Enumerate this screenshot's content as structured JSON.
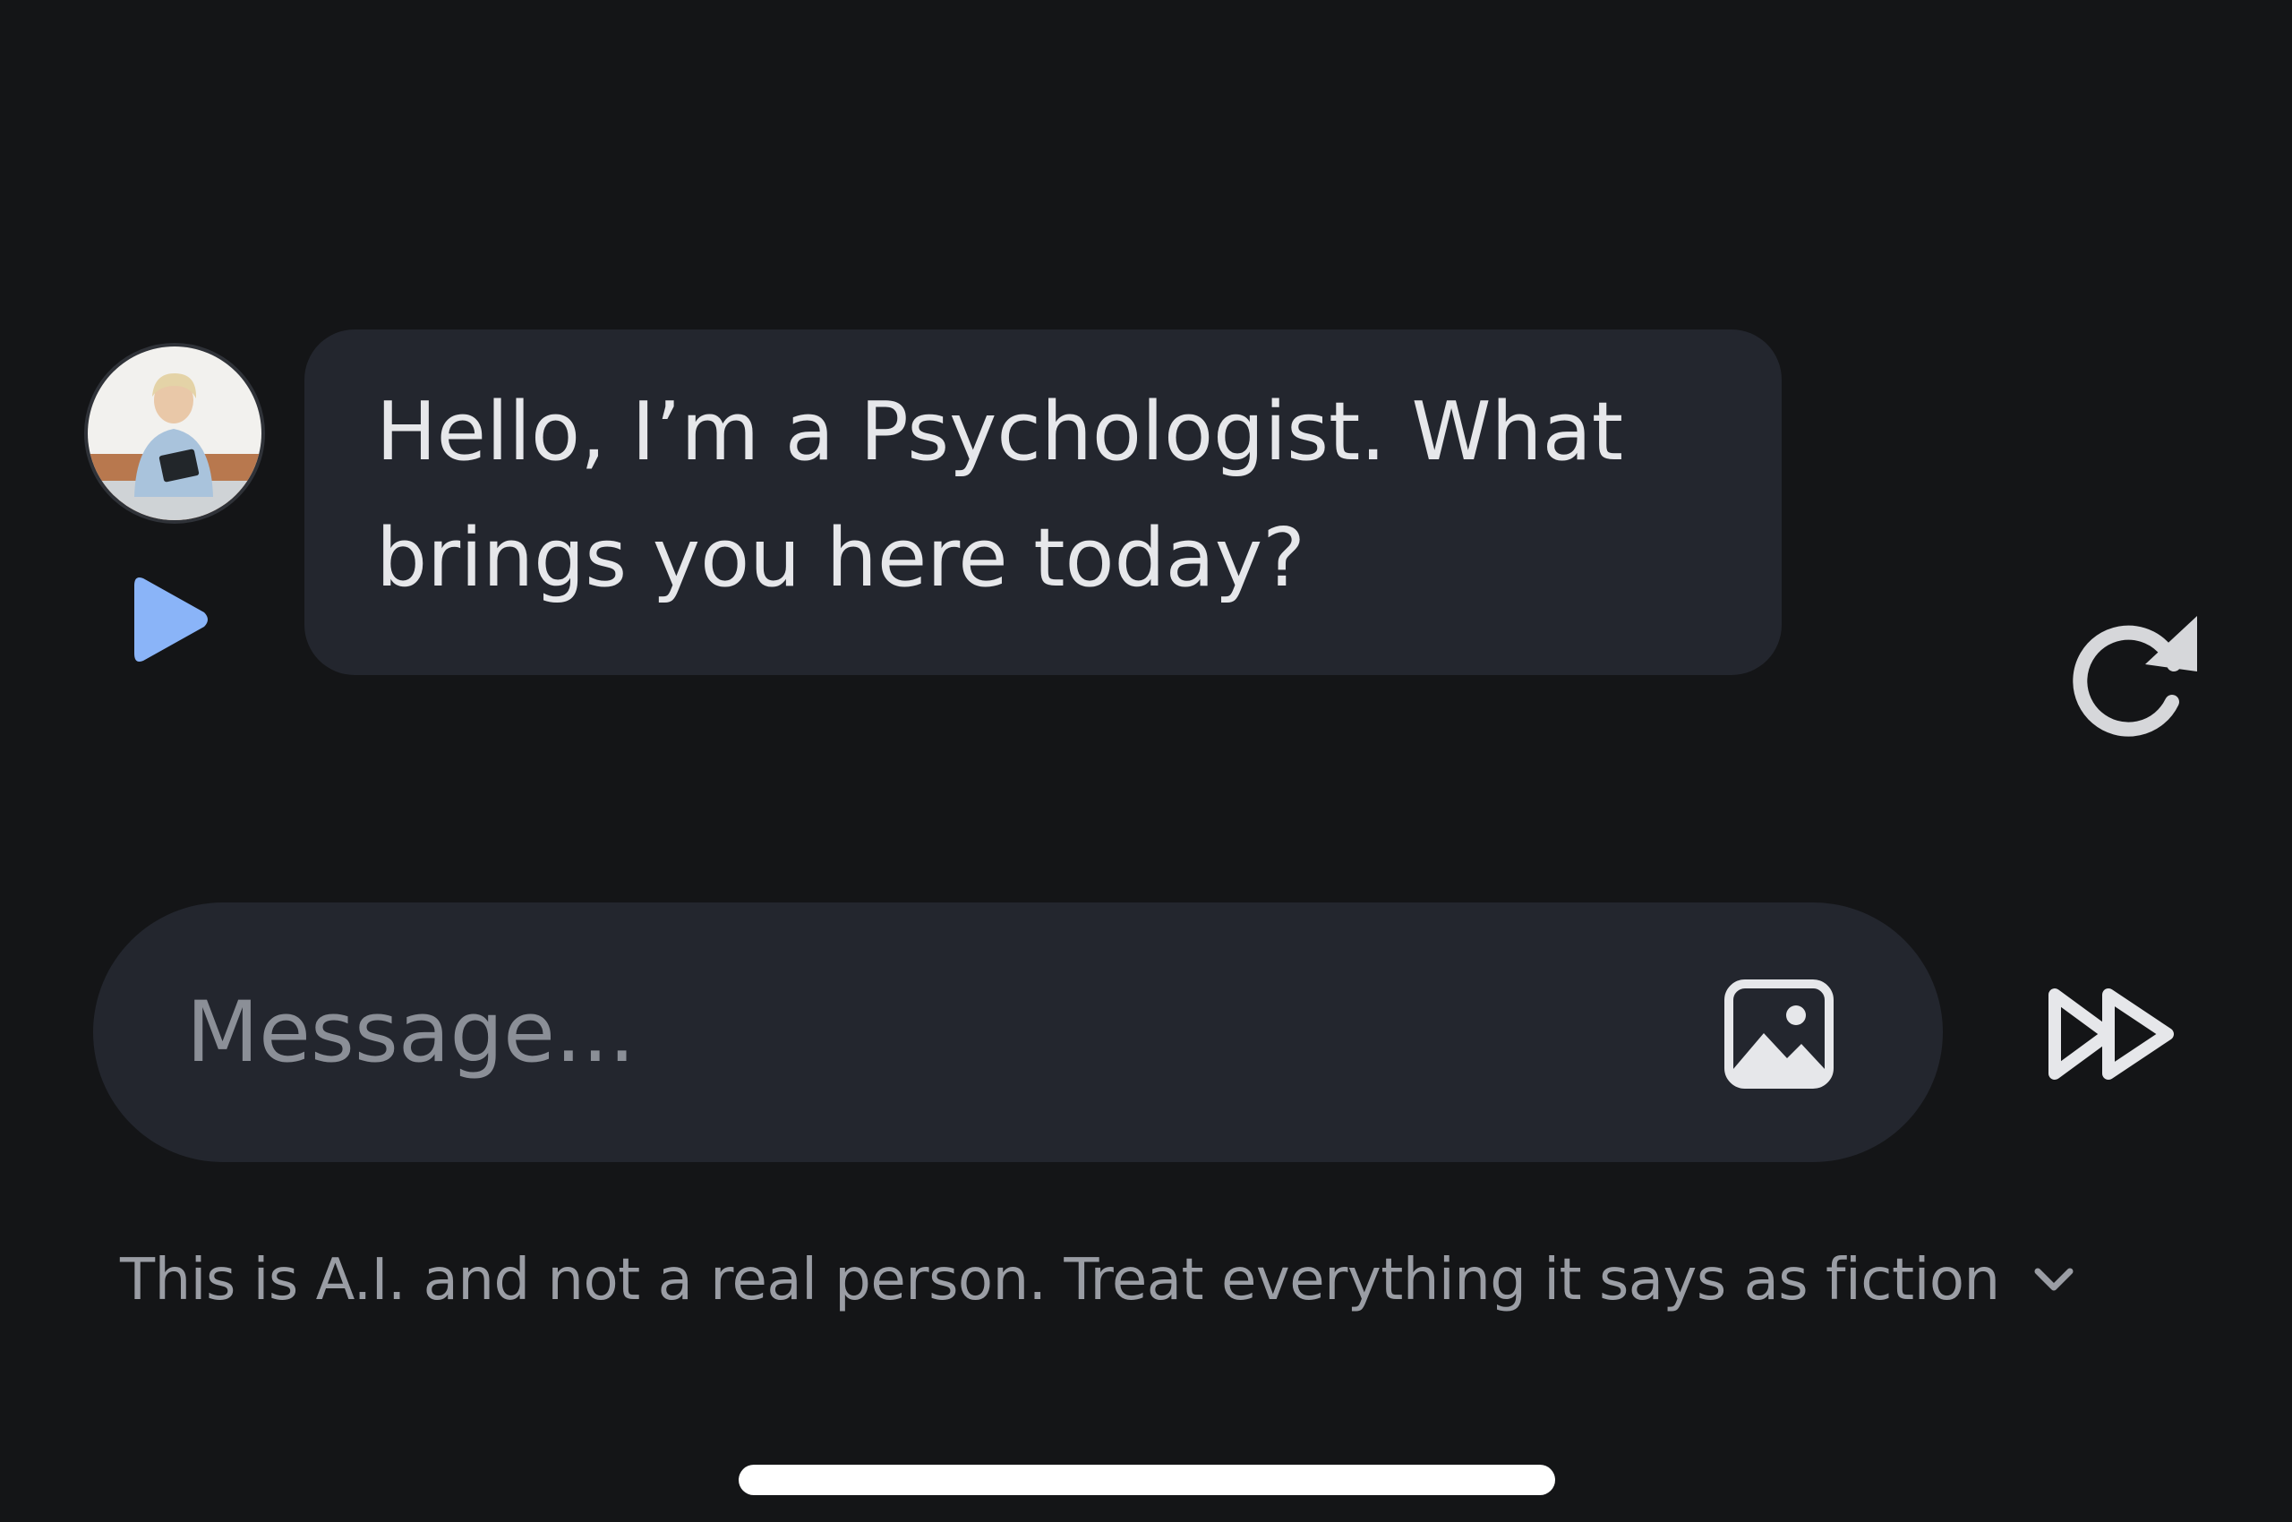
{
  "chat": {
    "messages": [
      {
        "sender": "Psychologist",
        "text": "Hello, I’m a Psychologist. What brings you here today?"
      }
    ]
  },
  "composer": {
    "placeholder": "Message..."
  },
  "footer": {
    "disclaimer": "This is A.I. and not a real person. Treat everything it says as fiction"
  },
  "icons": {
    "play": "play-icon",
    "regenerate": "refresh-icon",
    "image": "image-icon",
    "send": "fast-forward-icon",
    "chevron": "chevron-down-icon"
  },
  "colors": {
    "background": "#141517",
    "bubble": "#23262e",
    "accent_play": "#8ab4f8",
    "text_primary": "#e6e7ea",
    "text_secondary": "#9a9da4"
  }
}
